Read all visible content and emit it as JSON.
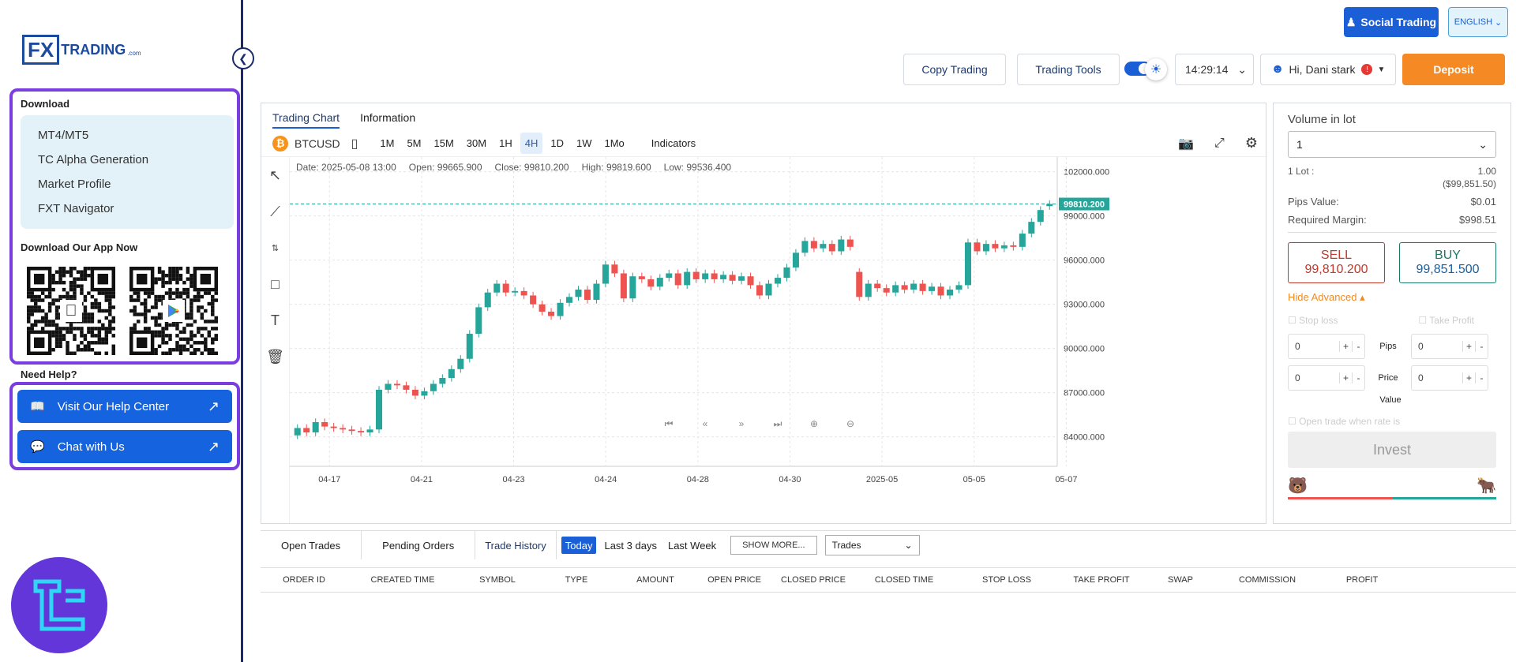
{
  "brand": {
    "logo_mark": "FX",
    "logo_text": "TRADING",
    "logo_suffix": ".com"
  },
  "sidebar": {
    "download_title": "Download",
    "download_items": [
      {
        "label": "MT4/MT5"
      },
      {
        "label": "TC Alpha Generation"
      },
      {
        "label": "Market Profile"
      },
      {
        "label": "FXT Navigator"
      }
    ],
    "app_title": "Download Our App Now",
    "help_title": "Need Help?",
    "help_buttons": [
      {
        "label": "Visit Our Help Center"
      },
      {
        "label": "Chat with Us"
      }
    ]
  },
  "header": {
    "social_trading": "Social Trading",
    "language": "ENGLISH",
    "copy_trading": "Copy Trading",
    "trading_tools": "Trading Tools",
    "time": "14:29:14",
    "greeting": "Hi,",
    "user_name": "Dani stark",
    "deposit": "Deposit"
  },
  "chart_tabs": [
    {
      "label": "Trading Chart"
    },
    {
      "label": "Information"
    }
  ],
  "toolbar": {
    "symbol": "BTCUSD",
    "timeframes": [
      "1M",
      "5M",
      "15M",
      "30M",
      "1H",
      "4H",
      "1D",
      "1W",
      "1Mo"
    ],
    "active_timeframe": "4H",
    "indicators": "Indicators"
  },
  "ohlc": {
    "date": "Date: 2025-05-08 13:00",
    "open": "Open: 99665.900",
    "close": "Close: 99810.200",
    "high": "High: 99819.600",
    "low": "Low: 99536.400"
  },
  "chart_data": {
    "type": "candlestick",
    "symbol": "BTCUSD",
    "interval": "4H",
    "ylim": [
      82000,
      103000
    ],
    "y_ticks": [
      "102000.000",
      "99000.000",
      "96000.000",
      "93000.000",
      "90000.000",
      "87000.000",
      "84000.000"
    ],
    "x_ticks": [
      "04-17",
      "04-21",
      "04-23",
      "04-24",
      "04-28",
      "04-30",
      "2025-05",
      "05-05",
      "05-07"
    ],
    "last_price_label": "99810.200",
    "last_price": 99810.2,
    "candles": [
      {
        "o": 84100,
        "c": 84600
      },
      {
        "o": 84600,
        "c": 84300
      },
      {
        "o": 84300,
        "c": 85000
      },
      {
        "o": 85000,
        "c": 84700
      },
      {
        "o": 84700,
        "c": 84600
      },
      {
        "o": 84600,
        "c": 84500
      },
      {
        "o": 84500,
        "c": 84400
      },
      {
        "o": 84400,
        "c": 84300
      },
      {
        "o": 84300,
        "c": 84500
      },
      {
        "o": 84500,
        "c": 87200
      },
      {
        "o": 87200,
        "c": 87600
      },
      {
        "o": 87600,
        "c": 87500
      },
      {
        "o": 87500,
        "c": 87200
      },
      {
        "o": 87200,
        "c": 86800
      },
      {
        "o": 86800,
        "c": 87100
      },
      {
        "o": 87100,
        "c": 87600
      },
      {
        "o": 87600,
        "c": 88000
      },
      {
        "o": 88000,
        "c": 88600
      },
      {
        "o": 88600,
        "c": 89300
      },
      {
        "o": 89300,
        "c": 91000
      },
      {
        "o": 91000,
        "c": 92800
      },
      {
        "o": 92800,
        "c": 93800
      },
      {
        "o": 93800,
        "c": 94400
      },
      {
        "o": 94400,
        "c": 93800
      },
      {
        "o": 93800,
        "c": 93900
      },
      {
        "o": 93900,
        "c": 93600
      },
      {
        "o": 93600,
        "c": 93000
      },
      {
        "o": 93000,
        "c": 92500
      },
      {
        "o": 92500,
        "c": 92200
      },
      {
        "o": 92200,
        "c": 93100
      },
      {
        "o": 93100,
        "c": 93500
      },
      {
        "o": 93500,
        "c": 94000
      },
      {
        "o": 94000,
        "c": 93300
      },
      {
        "o": 93300,
        "c": 94400
      },
      {
        "o": 94400,
        "c": 95700
      },
      {
        "o": 95700,
        "c": 95100
      },
      {
        "o": 95100,
        "c": 93400
      },
      {
        "o": 93400,
        "c": 94900
      },
      {
        "o": 94900,
        "c": 94700
      },
      {
        "o": 94700,
        "c": 94200
      },
      {
        "o": 94200,
        "c": 94800
      },
      {
        "o": 94800,
        "c": 95100
      },
      {
        "o": 95100,
        "c": 94300
      },
      {
        "o": 94300,
        "c": 95200
      },
      {
        "o": 95200,
        "c": 94700
      },
      {
        "o": 94700,
        "c": 95100
      },
      {
        "o": 95100,
        "c": 94700
      },
      {
        "o": 94700,
        "c": 95000
      },
      {
        "o": 95000,
        "c": 94600
      },
      {
        "o": 94600,
        "c": 94900
      },
      {
        "o": 94900,
        "c": 94300
      },
      {
        "o": 94300,
        "c": 93600
      },
      {
        "o": 93600,
        "c": 94400
      },
      {
        "o": 94400,
        "c": 94800
      },
      {
        "o": 94800,
        "c": 95500
      },
      {
        "o": 95500,
        "c": 96500
      },
      {
        "o": 96500,
        "c": 97300
      },
      {
        "o": 97300,
        "c": 96800
      },
      {
        "o": 96800,
        "c": 97100
      },
      {
        "o": 97100,
        "c": 96600
      },
      {
        "o": 96600,
        "c": 97400
      },
      {
        "o": 97400,
        "c": 96900
      },
      {
        "o": 95200,
        "c": 93500
      },
      {
        "o": 93500,
        "c": 94400
      },
      {
        "o": 94400,
        "c": 94100
      },
      {
        "o": 94100,
        "c": 93800
      },
      {
        "o": 93800,
        "c": 94300
      },
      {
        "o": 94300,
        "c": 94000
      },
      {
        "o": 94000,
        "c": 94400
      },
      {
        "o": 94400,
        "c": 93900
      },
      {
        "o": 93900,
        "c": 94200
      },
      {
        "o": 94200,
        "c": 93600
      },
      {
        "o": 93600,
        "c": 94000
      },
      {
        "o": 94000,
        "c": 94300
      },
      {
        "o": 94300,
        "c": 97200
      },
      {
        "o": 97200,
        "c": 96600
      },
      {
        "o": 96600,
        "c": 97100
      },
      {
        "o": 97100,
        "c": 96800
      },
      {
        "o": 96800,
        "c": 97000
      },
      {
        "o": 97000,
        "c": 96900
      },
      {
        "o": 96900,
        "c": 97800
      },
      {
        "o": 97800,
        "c": 98600
      },
      {
        "o": 98600,
        "c": 99400
      },
      {
        "o": 99665.9,
        "c": 99810.2
      }
    ]
  },
  "trade_panel": {
    "volume_label": "Volume in lot",
    "volume_value": "1",
    "lot_label": "1 Lot :",
    "lot_value": "1.00",
    "lot_value_usd": "($99,851.50)",
    "pips_value_label": "Pips Value:",
    "pips_value": "$0.01",
    "required_margin_label": "Required Margin:",
    "required_margin": "$998.51",
    "sell_label": "SELL",
    "sell_price": "99,810.200",
    "buy_label": "BUY",
    "buy_price": "99,851.500",
    "hide_advanced": "Hide Advanced",
    "stop_loss": "Stop loss",
    "take_profit": "Take Profit",
    "pips": "Pips",
    "price": "Price",
    "value": "Value",
    "zero": "0",
    "open_when": "Open trade when rate is",
    "invest": "Invest"
  },
  "bottom": {
    "tabs": [
      {
        "label": "Open Trades"
      },
      {
        "label": "Pending Orders"
      },
      {
        "label": "Trade History"
      }
    ],
    "filters": [
      {
        "label": "Today"
      },
      {
        "label": "Last 3 days"
      },
      {
        "label": "Last Week"
      }
    ],
    "show_more": "SHOW MORE...",
    "select_value": "Trades",
    "columns": [
      "ORDER ID",
      "CREATED TIME",
      "SYMBOL",
      "TYPE",
      "AMOUNT",
      "OPEN PRICE",
      "CLOSED PRICE",
      "CLOSED TIME",
      "STOP LOSS",
      "TAKE PROFIT",
      "SWAP",
      "COMMISSION",
      "PROFIT"
    ]
  },
  "colors": {
    "up": "#26a69a",
    "down": "#ef5350",
    "accent": "#1a5fd6",
    "purple": "#7a3ee0",
    "orange": "#f58a25"
  }
}
